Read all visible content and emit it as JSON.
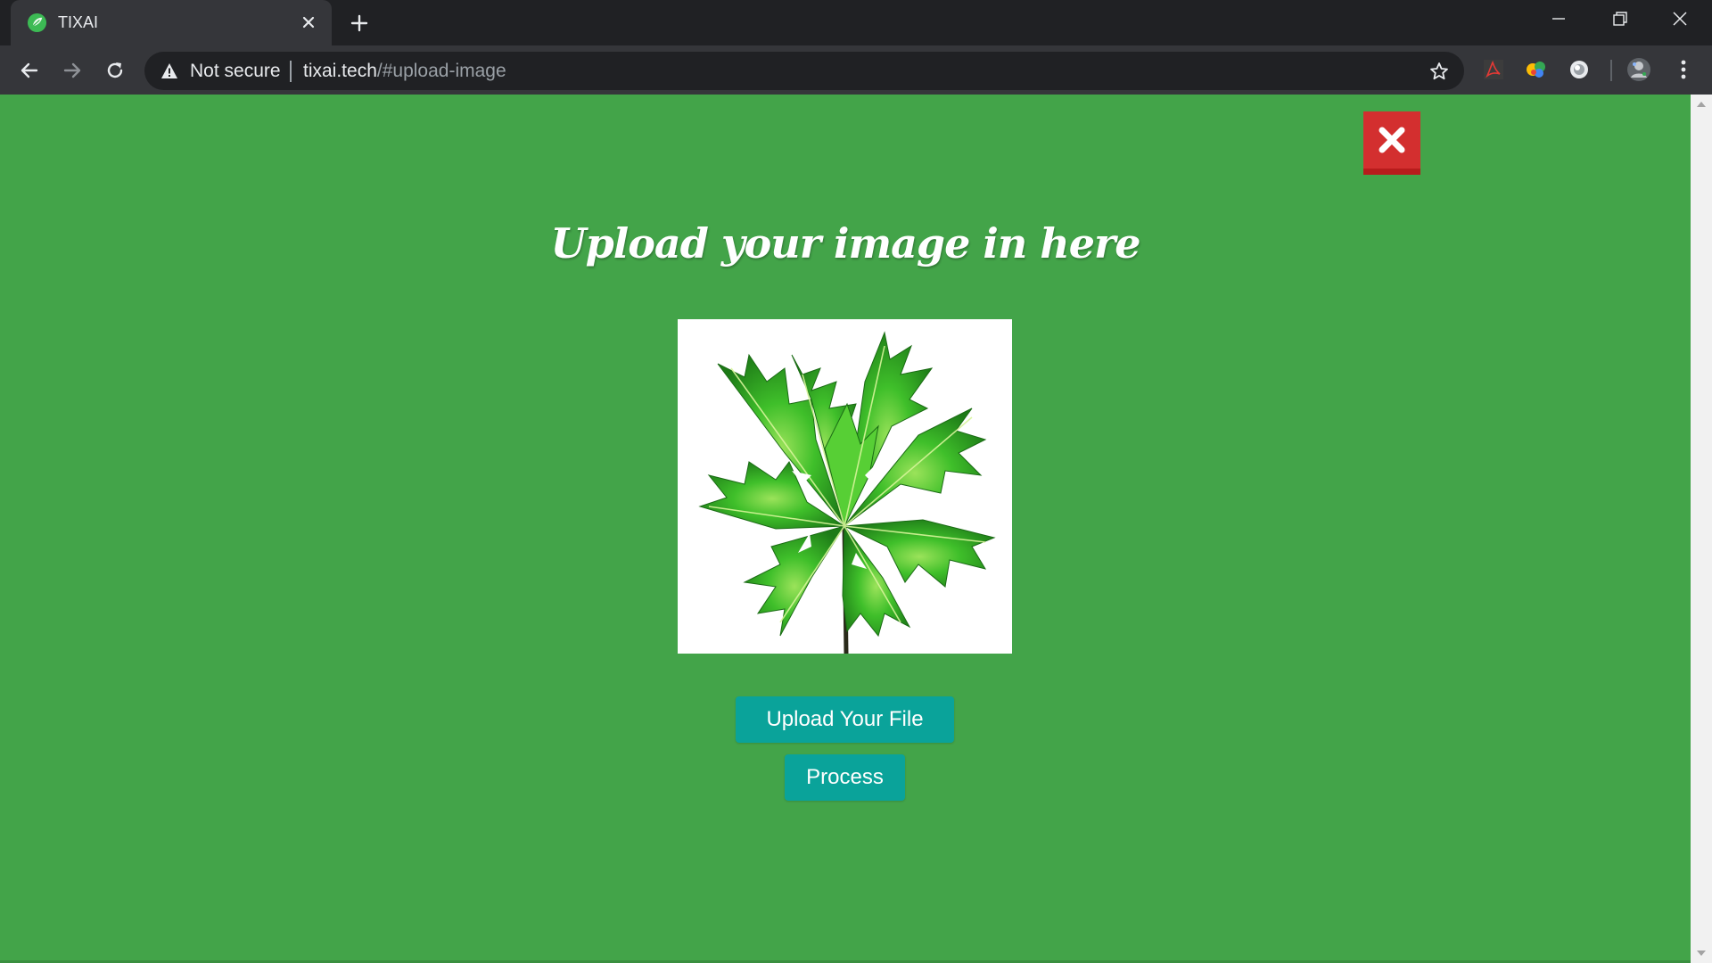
{
  "browser": {
    "tab": {
      "title": "TIXAI",
      "favicon": "leaf-favicon-icon",
      "close": "close-icon"
    },
    "new_tab": "plus-icon",
    "window_controls": [
      "minimize-icon",
      "restore-icon",
      "close-icon"
    ],
    "omnibox": {
      "security_icon": "warning-triangle-icon",
      "security_label": "Not secure",
      "url_host": "tixai.tech",
      "url_path": "/#upload-image",
      "bookmark_icon": "star-icon"
    },
    "extensions": [
      "acrobat-extension-icon",
      "colorful-extension-icon",
      "circle-extension-icon"
    ],
    "profile_icon": "profile-avatar-icon",
    "menu_icon": "kebab-menu-icon"
  },
  "page": {
    "background_color": "#43a449",
    "close_button_icon": "close-x-icon",
    "heading": "Upload your image in here",
    "image_alt_subject": "papaya-leaf-image",
    "upload_button_label": "Upload Your File",
    "process_button_label": "Process",
    "button_color": "#0aa39a",
    "close_color": "#d32f2f"
  }
}
